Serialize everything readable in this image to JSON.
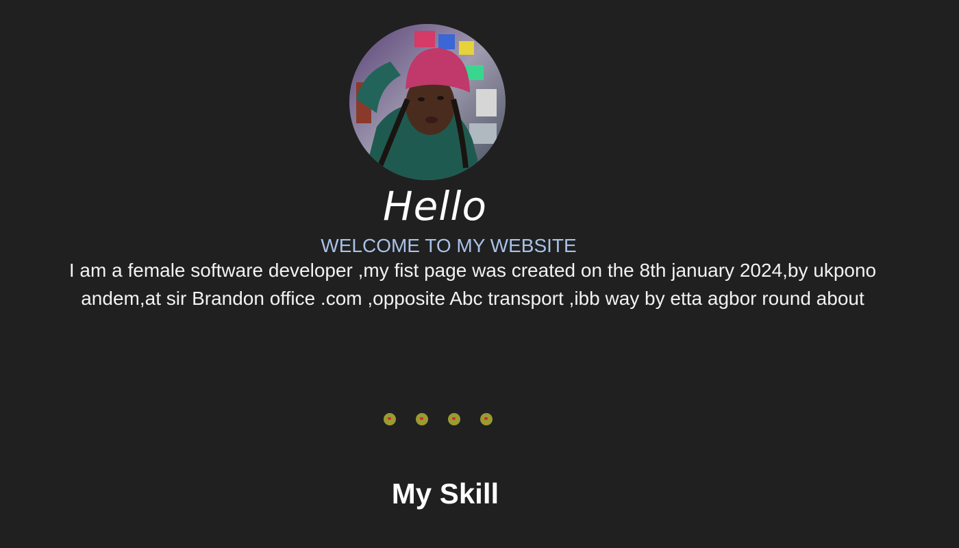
{
  "profile": {
    "avatar_icon": "profile-photo-avatar"
  },
  "hero": {
    "greeting": "Hello",
    "welcome": "WELCOME TO MY WEBSITE",
    "intro": "I am a female software developer ,my fist page was created on the 8th january 2024,by ukpono andem,at sir Brandon office .com ,opposite Abc transport ,ibb way by etta agbor round about"
  },
  "dots": {
    "count": 4,
    "icons": [
      "dot-icon",
      "dot-icon",
      "dot-icon",
      "dot-icon"
    ]
  },
  "skills": {
    "title": "My Skill"
  },
  "colors": {
    "background": "#202020",
    "welcome_text": "#a9c2e8",
    "dot_fill": "#9a9b31",
    "dot_center": "#d8283a"
  }
}
